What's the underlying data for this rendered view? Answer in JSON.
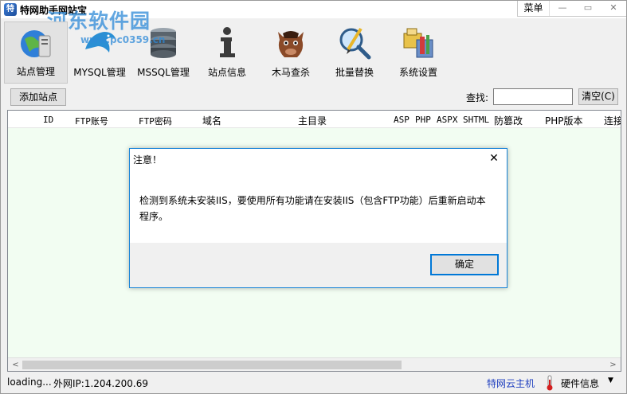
{
  "app": {
    "title": "特网助手网站宝",
    "watermark": "河东软件园",
    "watermark_url": "www.pc0359.cn"
  },
  "window": {
    "menu_label": "菜单",
    "minimize": "—",
    "maximize": "▭",
    "close": "✕"
  },
  "toolbar": {
    "items": [
      {
        "label": "站点管理"
      },
      {
        "label": "MYSQL管理"
      },
      {
        "label": "MSSQL管理"
      },
      {
        "label": "站点信息"
      },
      {
        "label": "木马查杀"
      },
      {
        "label": "批量替换"
      },
      {
        "label": "系统设置"
      }
    ]
  },
  "actions": {
    "add_site": "添加站点",
    "search_label": "查找:",
    "search_value": "",
    "clear": "清空(C)"
  },
  "table": {
    "columns": [
      "ID",
      "FTP账号",
      "FTP密码",
      "域名",
      "主目录",
      "ASP",
      "PHP",
      "ASPX",
      "SHTML",
      "防篡改",
      "PHP版本",
      "连接"
    ],
    "scroll_left": "<",
    "scroll_right": ">"
  },
  "status": {
    "loading": "loading...",
    "ip": "外网IP:1.204.200.69",
    "cloud": "特网云主机",
    "hardware": "硬件信息",
    "hardware_arrow": "▼"
  },
  "dialog": {
    "title": "注意！",
    "close": "✕",
    "message": "检测到系统未安装IIS，要使用所有功能请在安装IIS（包含FTP功能）后重新启动本程序。",
    "ok": "确定"
  },
  "colors": {
    "table_bg": "#f2fdf2",
    "dialog_border": "#1883d7",
    "link_blue": "#1f3fbf"
  }
}
